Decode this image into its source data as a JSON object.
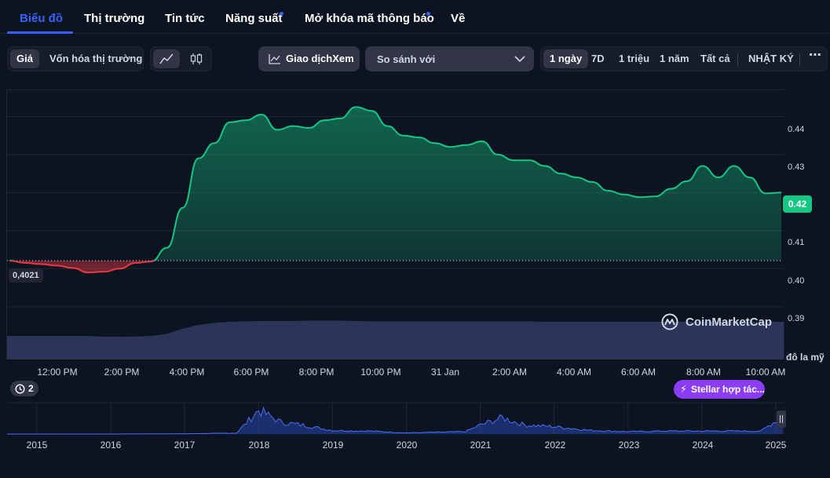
{
  "tabs": [
    {
      "label": "Biểu đồ",
      "active": true
    },
    {
      "label": "Thị trường"
    },
    {
      "label": "Tin tức"
    },
    {
      "label": "Năng suất",
      "dot": true
    },
    {
      "label": "Mở khóa mã thông báo",
      "dot": true
    },
    {
      "label": "Về"
    }
  ],
  "toolbar": {
    "metric_price": "Giá",
    "metric_cap": "Vốn hóa thị trường",
    "line_icon": "line-chart-icon",
    "candle_icon": "candlestick-icon",
    "volume_button": "Giao dịchXem",
    "compare_placeholder": "So sánh với",
    "ranges": [
      "1 ngày",
      "7D",
      "1 triệu",
      "1 năm",
      "Tất cả"
    ],
    "log_label": "NHẬT KÝ",
    "more_icon": "more-icon"
  },
  "chart": {
    "open_price_label": "0,4021",
    "current_price_label": "0.42",
    "y_unit_label": "đô la mỹ",
    "y_ticks": [
      "0.44",
      "0.43",
      "0.42",
      "0.41",
      "0.40",
      "0.39"
    ],
    "x_ticks": [
      "12:00 PM",
      "2:00 PM",
      "4:00 PM",
      "6:00 PM",
      "8:00 PM",
      "10:00 PM",
      "31 Jan",
      "2:00 AM",
      "4:00 AM",
      "6:00 AM",
      "8:00 AM",
      "10:00 AM"
    ],
    "watermark": "CoinMarketCap",
    "up_color": "#16c784",
    "down_color": "#ea3943"
  },
  "events": {
    "count": "2",
    "news_label": "Stellar hợp tác..."
  },
  "overview": {
    "years": [
      "2015",
      "2016",
      "2017",
      "2018",
      "2019",
      "2020",
      "2021",
      "2022",
      "2023",
      "2024",
      "2025"
    ]
  },
  "chart_data": {
    "type": "area",
    "x": [
      "11:00 AM",
      "11:30 AM",
      "12:00 PM",
      "12:30 PM",
      "1:00 PM",
      "1:30 PM",
      "2:00 PM",
      "2:30 PM",
      "3:00 PM",
      "3:30 PM",
      "4:00 PM",
      "4:15 PM",
      "4:30 PM",
      "5:00 PM",
      "5:30 PM",
      "6:00 PM",
      "6:30 PM",
      "7:00 PM",
      "7:30 PM",
      "8:00 PM",
      "8:30 PM",
      "9:00 PM",
      "9:15 PM",
      "9:30 PM",
      "10:00 PM",
      "10:30 PM",
      "11:00 PM",
      "11:30 PM",
      "31 Jan",
      "12:30 AM",
      "1:00 AM",
      "1:30 AM",
      "2:00 AM",
      "2:30 AM",
      "3:00 AM",
      "3:30 AM",
      "4:00 AM",
      "4:30 AM",
      "5:00 AM",
      "5:30 AM",
      "6:00 AM",
      "6:30 AM",
      "7:00 AM",
      "7:30 AM",
      "8:00 AM",
      "8:30 AM",
      "9:00 AM",
      "9:30 AM",
      "10:00 AM",
      "10:30 AM"
    ],
    "y": [
      0.4021,
      0.4015,
      0.4012,
      0.4008,
      0.4002,
      0.399,
      0.3992,
      0.4,
      0.4015,
      0.4019,
      0.4055,
      0.416,
      0.429,
      0.433,
      0.4385,
      0.439,
      0.4405,
      0.4365,
      0.4375,
      0.437,
      0.439,
      0.4395,
      0.4425,
      0.4415,
      0.4375,
      0.435,
      0.4345,
      0.433,
      0.432,
      0.4325,
      0.4335,
      0.43,
      0.4285,
      0.4285,
      0.427,
      0.425,
      0.424,
      0.4228,
      0.4205,
      0.4195,
      0.4188,
      0.419,
      0.421,
      0.423,
      0.427,
      0.424,
      0.427,
      0.424,
      0.4198,
      0.42
    ],
    "volume": [
      0.6,
      0.6,
      0.6,
      0.6,
      0.6,
      0.6,
      0.58,
      0.58,
      0.58,
      0.6,
      0.65,
      0.78,
      0.88,
      0.93,
      0.96,
      0.97,
      0.98,
      0.98,
      0.98,
      0.99,
      0.99,
      0.99,
      0.98,
      0.97,
      0.97,
      0.97,
      0.97,
      0.97,
      0.97,
      0.97,
      0.97,
      0.97,
      0.97,
      0.97,
      0.96,
      0.96,
      0.96,
      0.96,
      0.96,
      0.96,
      0.96,
      0.96,
      0.96,
      0.96,
      0.96,
      0.96,
      0.96,
      0.96,
      0.96,
      0.96
    ],
    "ylim": [
      0.385,
      0.45
    ],
    "reference_value": 0.4021,
    "xlabel": "",
    "ylabel": "đô la mỹ",
    "grid": true,
    "overview_series": [
      {
        "x": 2015,
        "y": 0.0
      },
      {
        "x": 2016,
        "y": 0.0
      },
      {
        "x": 2017,
        "y": 0.01
      },
      {
        "x": 2017.7,
        "y": 0.03
      },
      {
        "x": 2018,
        "y": 0.8
      },
      {
        "x": 2018.3,
        "y": 0.4
      },
      {
        "x": 2018.6,
        "y": 0.3
      },
      {
        "x": 2019,
        "y": 0.12
      },
      {
        "x": 2019.5,
        "y": 0.1
      },
      {
        "x": 2020,
        "y": 0.04
      },
      {
        "x": 2020.8,
        "y": 0.08
      },
      {
        "x": 2021,
        "y": 0.3
      },
      {
        "x": 2021.3,
        "y": 0.55
      },
      {
        "x": 2021.6,
        "y": 0.3
      },
      {
        "x": 2022,
        "y": 0.25
      },
      {
        "x": 2022.5,
        "y": 0.12
      },
      {
        "x": 2023,
        "y": 0.08
      },
      {
        "x": 2023.5,
        "y": 0.1
      },
      {
        "x": 2024,
        "y": 0.1
      },
      {
        "x": 2024.8,
        "y": 0.1
      },
      {
        "x": 2025,
        "y": 0.45
      },
      {
        "x": 2025.1,
        "y": 0.4
      }
    ]
  }
}
